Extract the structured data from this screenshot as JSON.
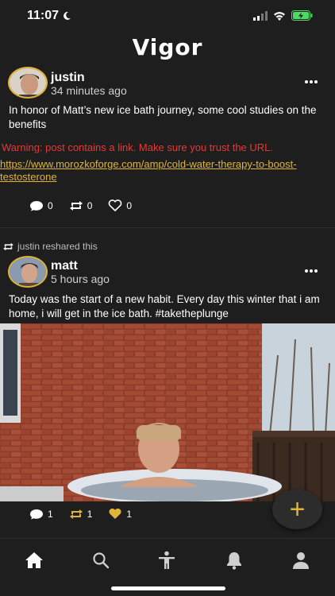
{
  "status_bar": {
    "time": "11:07"
  },
  "app": {
    "brand": "Vigor"
  },
  "posts": [
    {
      "username": "justin",
      "timestamp": "34 minutes ago",
      "text": "In honor of Matt’s new ice bath journey, some cool studies on the benefits",
      "warning": "Warning: post contains a link. Make sure you trust the URL.",
      "link": "https://www.morozkoforge.com/amp/cold-water-therapy-to-boost-testosterone",
      "comments": "0",
      "reshares": "0",
      "likes": "0",
      "liked": false
    },
    {
      "reshare_label": "justin reshared this",
      "username": "matt",
      "timestamp": "5 hours ago",
      "text": "Today was the start of a new habit. Every day this winter that i am home, i will get in the ice bath. #taketheplunge",
      "comments": "1",
      "reshares": "1",
      "likes": "1",
      "liked": true
    }
  ],
  "fab": {
    "label": "+"
  },
  "tabs": [
    "home",
    "search",
    "activity",
    "notifications",
    "profile"
  ],
  "colors": {
    "accent": "#e0b43a",
    "warning": "#e53935",
    "background": "#1e1e1e"
  }
}
